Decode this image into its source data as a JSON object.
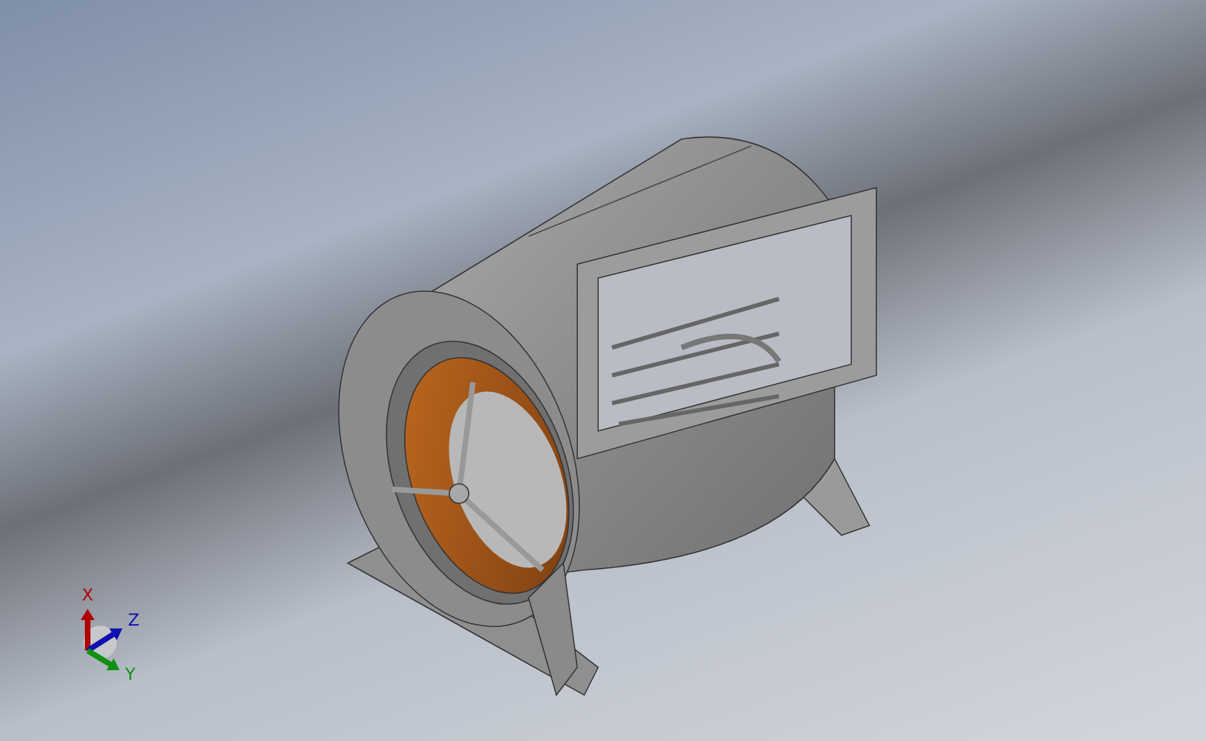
{
  "viewport": {
    "triad": {
      "axes": [
        {
          "kind": "up",
          "label": "X",
          "color": "#b00000"
        },
        {
          "kind": "back",
          "label": "Z",
          "color": "#1010b0"
        },
        {
          "kind": "right",
          "label": "Y",
          "color": "#109010"
        }
      ]
    }
  }
}
